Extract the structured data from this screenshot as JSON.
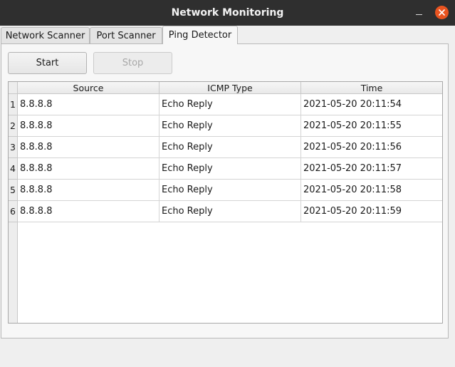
{
  "window": {
    "title": "Network Monitoring"
  },
  "icons": {
    "minimize": "minimize-icon",
    "close": "close-icon"
  },
  "colors": {
    "titlebar": "#2f2f2f",
    "close_button": "#e95420"
  },
  "tabs": [
    {
      "label": "Network Scanner",
      "active": false
    },
    {
      "label": "Port Scanner",
      "active": false
    },
    {
      "label": "Ping Detector",
      "active": true
    }
  ],
  "toolbar": {
    "start_label": "Start",
    "stop_label": "Stop",
    "stop_enabled": false
  },
  "table": {
    "columns": [
      "Source",
      "ICMP Type",
      "Time"
    ],
    "rows": [
      {
        "num": "1",
        "source": "8.8.8.8",
        "icmp_type": "Echo Reply",
        "time": "2021-05-20 20:11:54"
      },
      {
        "num": "2",
        "source": "8.8.8.8",
        "icmp_type": "Echo Reply",
        "time": "2021-05-20 20:11:55"
      },
      {
        "num": "3",
        "source": "8.8.8.8",
        "icmp_type": "Echo Reply",
        "time": "2021-05-20 20:11:56"
      },
      {
        "num": "4",
        "source": "8.8.8.8",
        "icmp_type": "Echo Reply",
        "time": "2021-05-20 20:11:57"
      },
      {
        "num": "5",
        "source": "8.8.8.8",
        "icmp_type": "Echo Reply",
        "time": "2021-05-20 20:11:58"
      },
      {
        "num": "6",
        "source": "8.8.8.8",
        "icmp_type": "Echo Reply",
        "time": "2021-05-20 20:11:59"
      }
    ]
  }
}
